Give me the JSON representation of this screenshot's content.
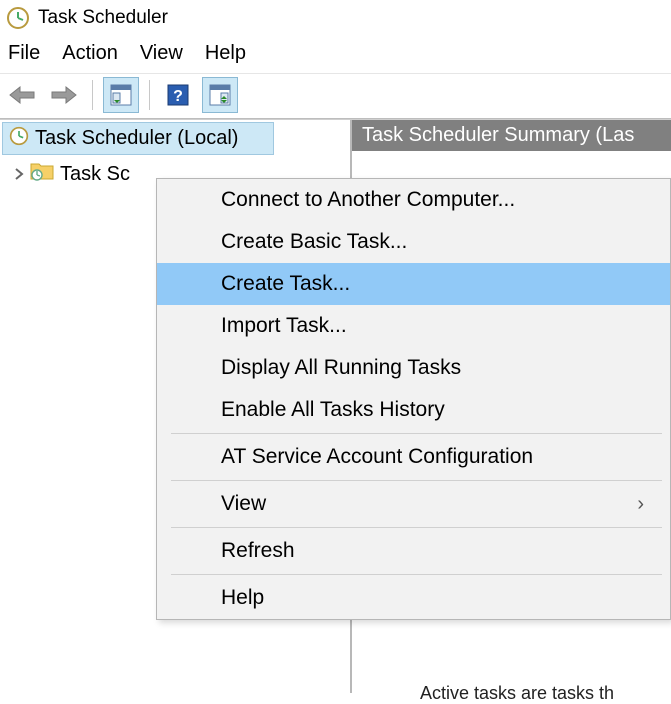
{
  "app_title": "Task Scheduler",
  "menubar": {
    "file": "File",
    "action": "Action",
    "view": "View",
    "help": "Help"
  },
  "tree": {
    "root_label": "Task Scheduler (Local)",
    "child_label": "Task Sc"
  },
  "summary_header": "Task Scheduler Summary (Las",
  "context_menu": {
    "items": [
      "Connect to Another Computer...",
      "Create Basic Task...",
      "Create Task...",
      "Import Task...",
      "Display All Running Tasks",
      "Enable All Tasks History",
      "AT Service Account Configuration",
      "View",
      "Refresh",
      "Help"
    ],
    "submenu_indicator": "›"
  },
  "cutoff": "Active tasks are tasks th"
}
